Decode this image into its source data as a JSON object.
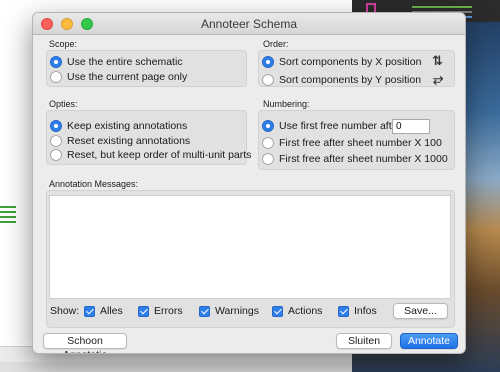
{
  "window": {
    "title": "Annoteer Schema"
  },
  "scope": {
    "label": "Scope:",
    "options": [
      "Use the entire schematic",
      "Use the current page only"
    ],
    "selected": 0
  },
  "order": {
    "label": "Order:",
    "options": [
      "Sort components by X position",
      "Sort components by Y position"
    ],
    "selected": 0,
    "icons": [
      "sort-x-icon",
      "sort-y-icon"
    ]
  },
  "opties": {
    "label": "Opties:",
    "options": [
      "Keep existing annotations",
      "Reset existing annotations",
      "Reset, but keep order of multi-unit parts"
    ],
    "selected": 0
  },
  "numbering": {
    "label": "Numbering:",
    "options": [
      "Use first free number after:",
      "First free after sheet number X 100",
      "First free after sheet number X 1000"
    ],
    "selected": 0,
    "start_value": "0"
  },
  "messages": {
    "label": "Annotation Messages:"
  },
  "filters": {
    "label": "Show:",
    "items": [
      {
        "label": "Alles",
        "checked": true
      },
      {
        "label": "Errors",
        "checked": true
      },
      {
        "label": "Warnings",
        "checked": true
      },
      {
        "label": "Actions",
        "checked": true
      },
      {
        "label": "Infos",
        "checked": true
      }
    ],
    "save_label": "Save..."
  },
  "buttons": {
    "clear": "Schoon Annotatie",
    "close": "Sluiten",
    "annotate": "Annotate"
  },
  "colors": {
    "accent": "#2f7fea",
    "dialog_bg": "#ececec"
  }
}
